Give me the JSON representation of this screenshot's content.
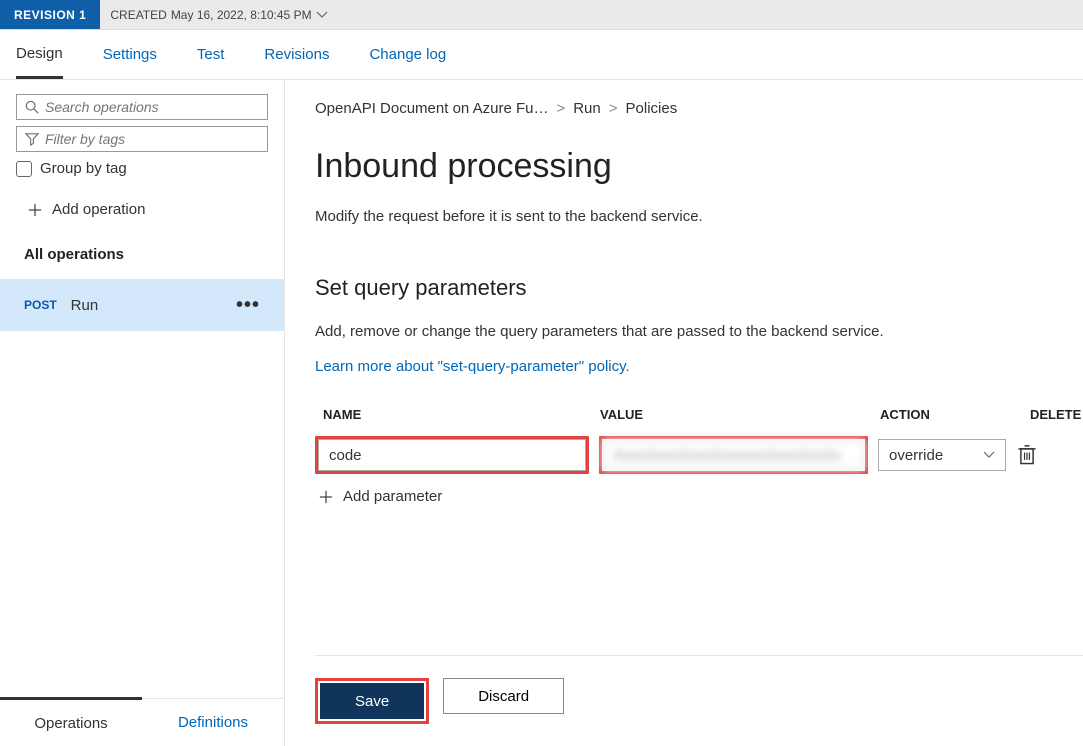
{
  "revision": {
    "badge": "REVISION 1",
    "meta_prefix": "CREATED",
    "meta_time": "May 16, 2022, 8:10:45 PM"
  },
  "tabs": {
    "design": "Design",
    "settings": "Settings",
    "test": "Test",
    "revisions": "Revisions",
    "changelog": "Change log"
  },
  "search": {
    "placeholder": "Search operations"
  },
  "filter": {
    "placeholder": "Filter by tags"
  },
  "group_by_tag": "Group by tag",
  "add_operation": "Add operation",
  "all_operations": "All operations",
  "op": {
    "method": "POST",
    "name": "Run"
  },
  "left_tabs": {
    "operations": "Operations",
    "definitions": "Definitions"
  },
  "crumbs": {
    "api": "OpenAPI Document on Azure Fu…",
    "op": "Run",
    "page": "Policies"
  },
  "title": "Inbound processing",
  "subtitle": "Modify the request before it is sent to the backend service.",
  "section": "Set query parameters",
  "section_desc": "Add, remove or change the query parameters that are passed to the backend service.",
  "learn_more": "Learn more about \"set-query-parameter\" policy.",
  "columns": {
    "name": "NAME",
    "value": "VALUE",
    "action": "ACTION",
    "delete": "DELETE"
  },
  "row": {
    "name": "code",
    "value": "XxxxXxxxXxxxXxxxxxxXxxxXxxXx",
    "action": "override"
  },
  "add_parameter": "Add parameter",
  "buttons": {
    "save": "Save",
    "discard": "Discard"
  }
}
